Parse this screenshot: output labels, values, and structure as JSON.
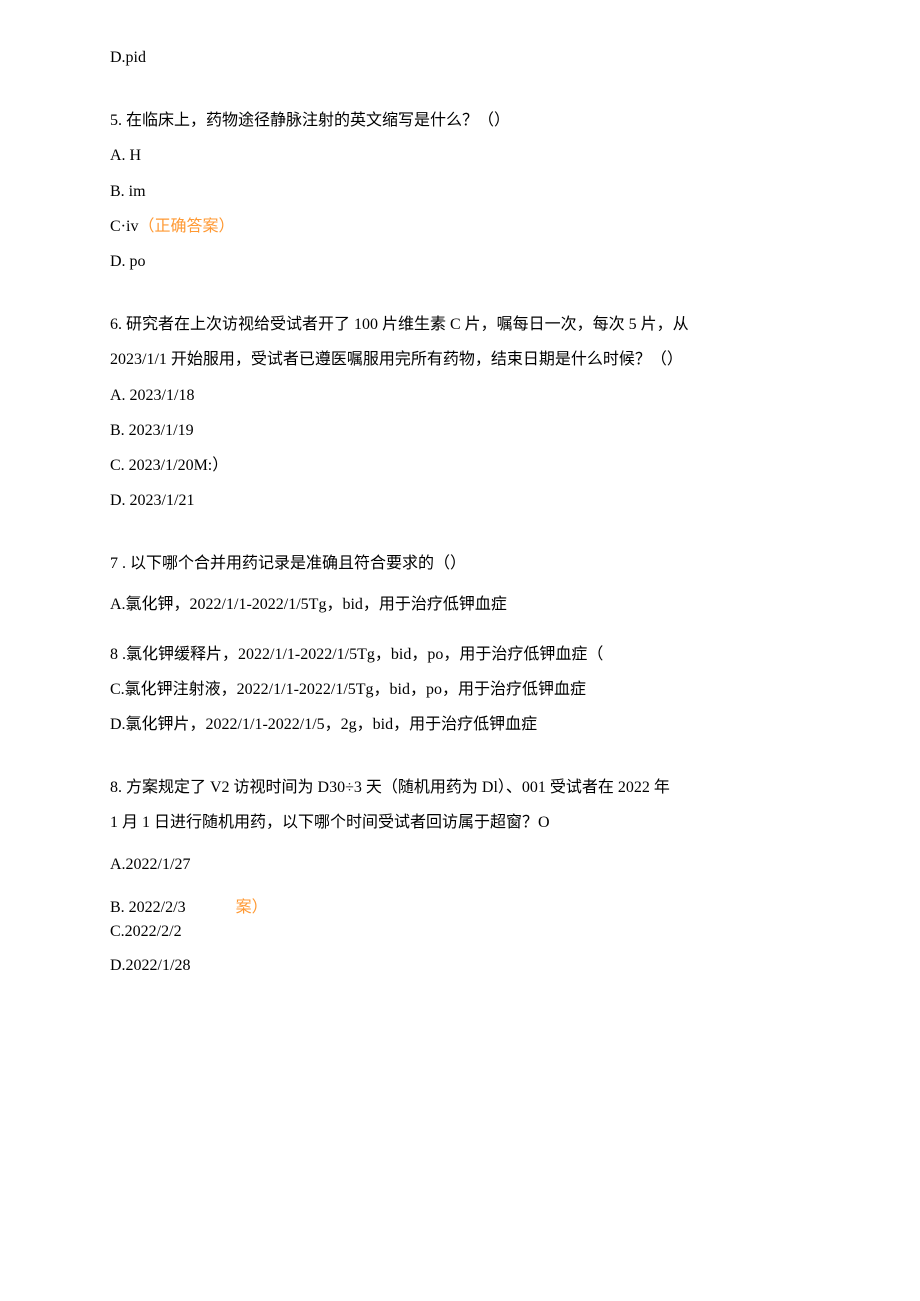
{
  "q4": {
    "optionD": "D.pid"
  },
  "q5": {
    "text": "5. 在临床上，药物途径静脉注射的英文缩写是什么？（）",
    "optionA": "A.   H",
    "optionB": "B.   im",
    "optionC_prefix": "C·iv",
    "optionC_correct": "（正确答案）",
    "optionD": "D.   po"
  },
  "q6": {
    "text1": "6. 研究者在上次访视给受试者开了 100 片维生素 C 片，嘱每日一次，每次 5 片，从",
    "text2": "2023/1/1 开始服用，受试者已遵医嘱服用完所有药物，结束日期是什么时候？（）",
    "optionA": "A.   2023/1/18",
    "optionB": "B.   2023/1/19",
    "optionC": "C.   2023/1/20M:）",
    "optionD": "D.   2023/1/21"
  },
  "q7": {
    "text": "7  . 以下哪个合并用药记录是准确且符合要求的（）",
    "optionA": "A.氯化钾，2022/1/1-2022/1/5Tg，bid，用于治疗低钾血症",
    "optionB": "8    .氯化钾缓释片，2022/1/1-2022/1/5Tg，bid，po，用于治疗低钾血症（",
    "optionC": "C.氯化钾注射液，2022/1/1-2022/1/5Tg，bid，po，用于治疗低钾血症",
    "optionD": "D.氯化钾片，2022/1/1-2022/1/5，2g，bid，用于治疗低钾血症"
  },
  "q8": {
    "text1": "8. 方案规定了 V2 访视时间为 D30÷3 天（随机用药为 Dl）、001 受试者在 2022 年",
    "text2": "1 月 1 日进行随机用药，以下哪个时间受试者回访属于超窗？O",
    "optionA": "A.2022/1/27",
    "optionB": " B. 2022/2/3",
    "optionB_correct": "案）",
    "optionC": "C.2022/2/2",
    "optionD": "D.2022/1/28"
  }
}
